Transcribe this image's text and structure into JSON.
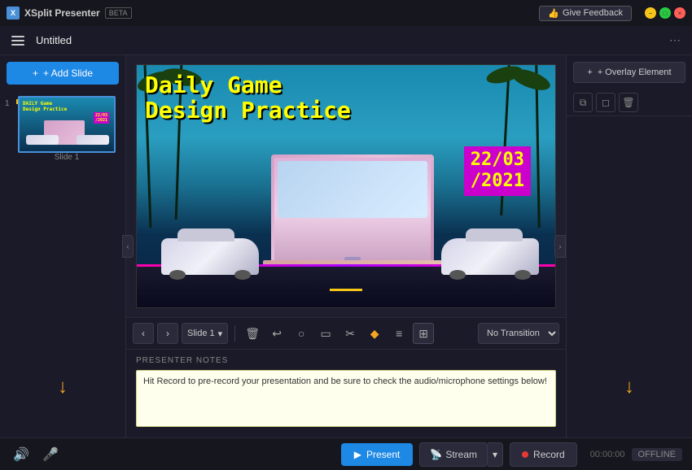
{
  "titleBar": {
    "appName": "XSplit Presenter",
    "betaLabel": "BETA",
    "feedbackBtn": "Give Feedback",
    "title": "Untitled"
  },
  "menuBar": {
    "title": "Untitled"
  },
  "sidebar": {
    "addSlideBtn": "+ Add Slide",
    "slideLabel": "Slide 1"
  },
  "toolbar": {
    "prevBtn": "‹",
    "nextBtn": "›",
    "slideSelector": "Slide 1",
    "deleteIcon": "🗑",
    "undoIcon": "↩",
    "ellipseIcon": "○",
    "rectIcon": "□",
    "cropIcon": "✂",
    "fillIcon": "⬥",
    "listIcon": "≡",
    "gridIcon": "⊞",
    "transitionSelect": "No Transition"
  },
  "notes": {
    "label": "PRESENTER NOTES",
    "text": "Hit Record to pre-record your presentation and be sure to check the audio/microphone settings below!"
  },
  "rightPanel": {
    "overlayBtn": "+ Overlay Element"
  },
  "slideContent": {
    "title1": "Daily Game",
    "title2": "Design Practice",
    "date": "22/03\n/2021"
  },
  "statusBar": {
    "presentBtn": "Present",
    "streamBtn": "Stream",
    "recordBtn": "Record",
    "timeText": "00:00:00",
    "offlineText": "OFFLINE"
  }
}
